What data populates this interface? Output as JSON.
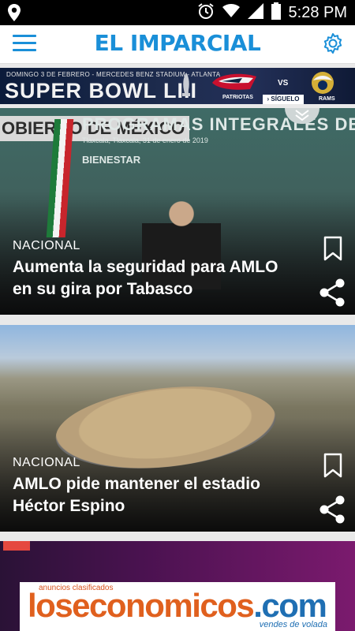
{
  "status_bar": {
    "time": "5:28 PM",
    "icons": [
      "location-icon",
      "alarm-icon",
      "wifi-icon",
      "signal-icon",
      "battery-icon"
    ]
  },
  "header": {
    "title": "EL IMPARCIAL",
    "brand_color": "#1a8fd8",
    "icons": [
      "menu-icon",
      "gear-icon"
    ]
  },
  "banner": {
    "subtitle": "DOMINGO 3  DE FEBRERO - MERCEDES BENZ STADIUM - ATLANTA",
    "title": "SUPER BOWL LIII",
    "team1": "PATRIOTAS",
    "vs": "VS",
    "team2": "RAMS",
    "follow_label": "› SÍGUELO"
  },
  "articles": [
    {
      "category": "NACIONAL",
      "headline": "Aumenta la seguridad para AMLO en su gira por Tabasco",
      "image_text": {
        "left_sign": "OBIERNO DE MÉXICO",
        "sign": "PROGRAMAS INTEGRALES DE DESARROL",
        "sign_sub": "Tlaxcala, Tlaxcala, 31 de enero de 2019",
        "sign_brand": "BIENESTAR"
      }
    },
    {
      "category": "NACIONAL",
      "headline": "AMLO pide mantener el estadio Héctor Espino"
    }
  ],
  "ad": {
    "small_text": "anuncios clasificados",
    "brand": "loseconomicos.com",
    "brand_main": "loseconomicos",
    "brand_tld": ".com",
    "tagline": "vendes de volada"
  }
}
